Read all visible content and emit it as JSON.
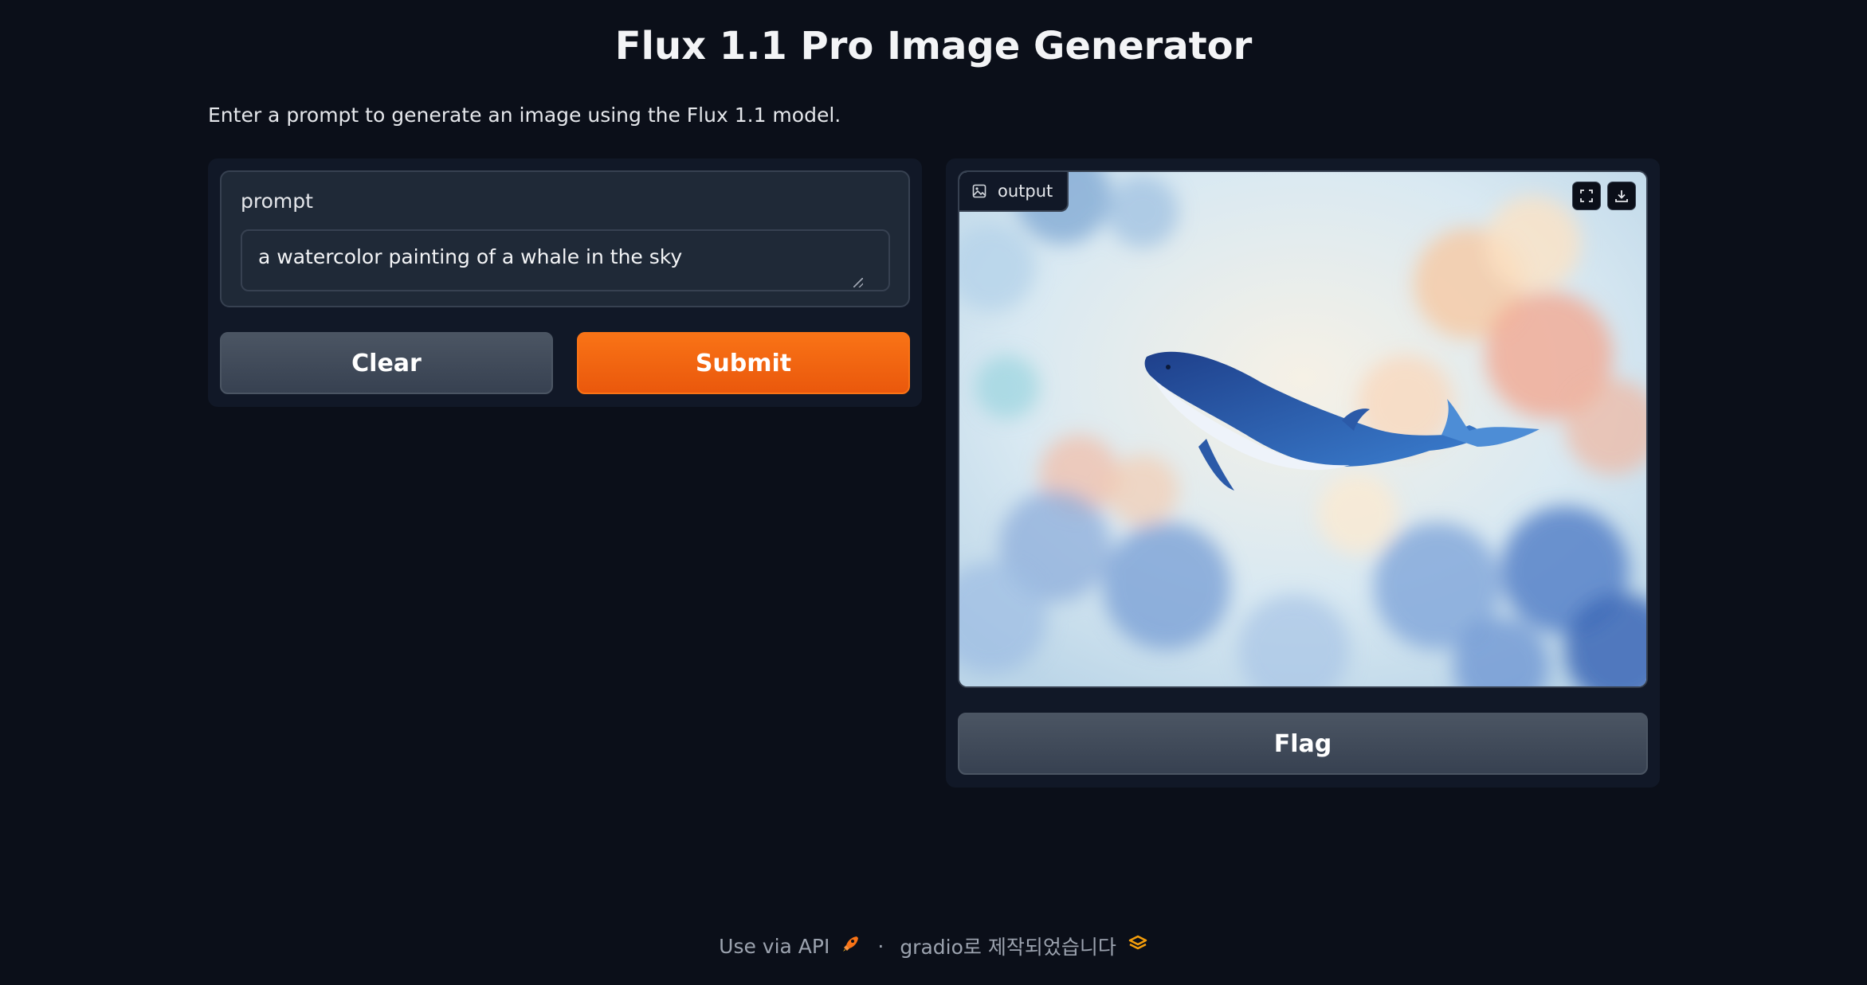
{
  "page": {
    "title": "Flux 1.1 Pro Image Generator",
    "description": "Enter a prompt to generate an image using the Flux 1.1 model."
  },
  "input": {
    "label": "prompt",
    "value": "a watercolor painting of a whale in the sky"
  },
  "buttons": {
    "clear": "Clear",
    "submit": "Submit",
    "flag": "Flag"
  },
  "output": {
    "label": "output",
    "image_icon": "image-icon",
    "fullscreen_icon": "fullscreen-icon",
    "download_icon": "download-icon"
  },
  "footer": {
    "api_link": "Use via API",
    "separator": "·",
    "built_with": "gradio로 제작되었습니다"
  },
  "colors": {
    "background": "#0b0f19",
    "panel": "#111827",
    "primary": "#f97316",
    "secondary": "#4b5563"
  }
}
